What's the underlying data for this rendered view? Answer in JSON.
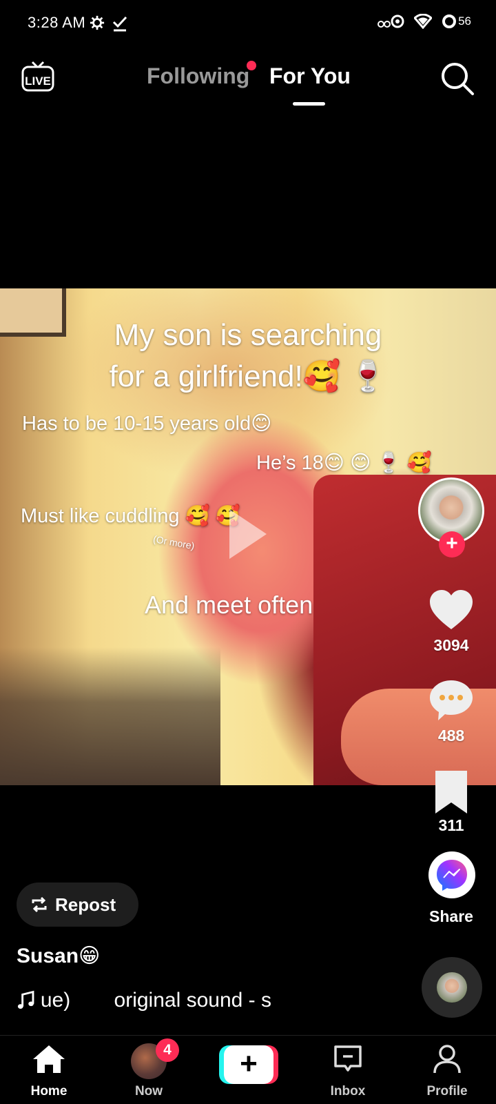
{
  "status_bar": {
    "time": "3:28 AM",
    "battery": "56",
    "icons": [
      "gear-icon",
      "check-icon",
      "dual-sim-icon",
      "wifi-icon",
      "battery-icon"
    ]
  },
  "top_nav": {
    "live_label": "LIVE",
    "tabs": [
      {
        "label": "Following",
        "active": false,
        "has_dot": true
      },
      {
        "label": "For You",
        "active": true
      }
    ],
    "accent_color": "#fe2c55"
  },
  "video": {
    "title_line1": "My son is searching",
    "title_line2": "for a girlfriend!🥰 🍷",
    "line_age": "Has to be 10-15 years old😊",
    "line_he": "He’s 18😊 😊 🍷 🥰",
    "line_cuddling": "Must like cuddling 🥰 🥰",
    "line_or_more": "(Or more)",
    "line_meet": "And meet often"
  },
  "actions": {
    "likes": "3094",
    "comments": "488",
    "saves": "311",
    "share_label": "Share",
    "follow_symbol": "+"
  },
  "post": {
    "repost_label": "Repost",
    "username": "Susan😁",
    "sound_prefix": "ue)",
    "sound_name": "original sound - s"
  },
  "bottom_nav": {
    "items": [
      {
        "label": "Home",
        "icon": "home-icon",
        "active": true
      },
      {
        "label": "Now",
        "icon": "now-avatar",
        "badge": "4"
      },
      {
        "label": "",
        "icon": "create-plus-icon"
      },
      {
        "label": "Inbox",
        "icon": "inbox-icon"
      },
      {
        "label": "Profile",
        "icon": "profile-icon"
      }
    ]
  }
}
